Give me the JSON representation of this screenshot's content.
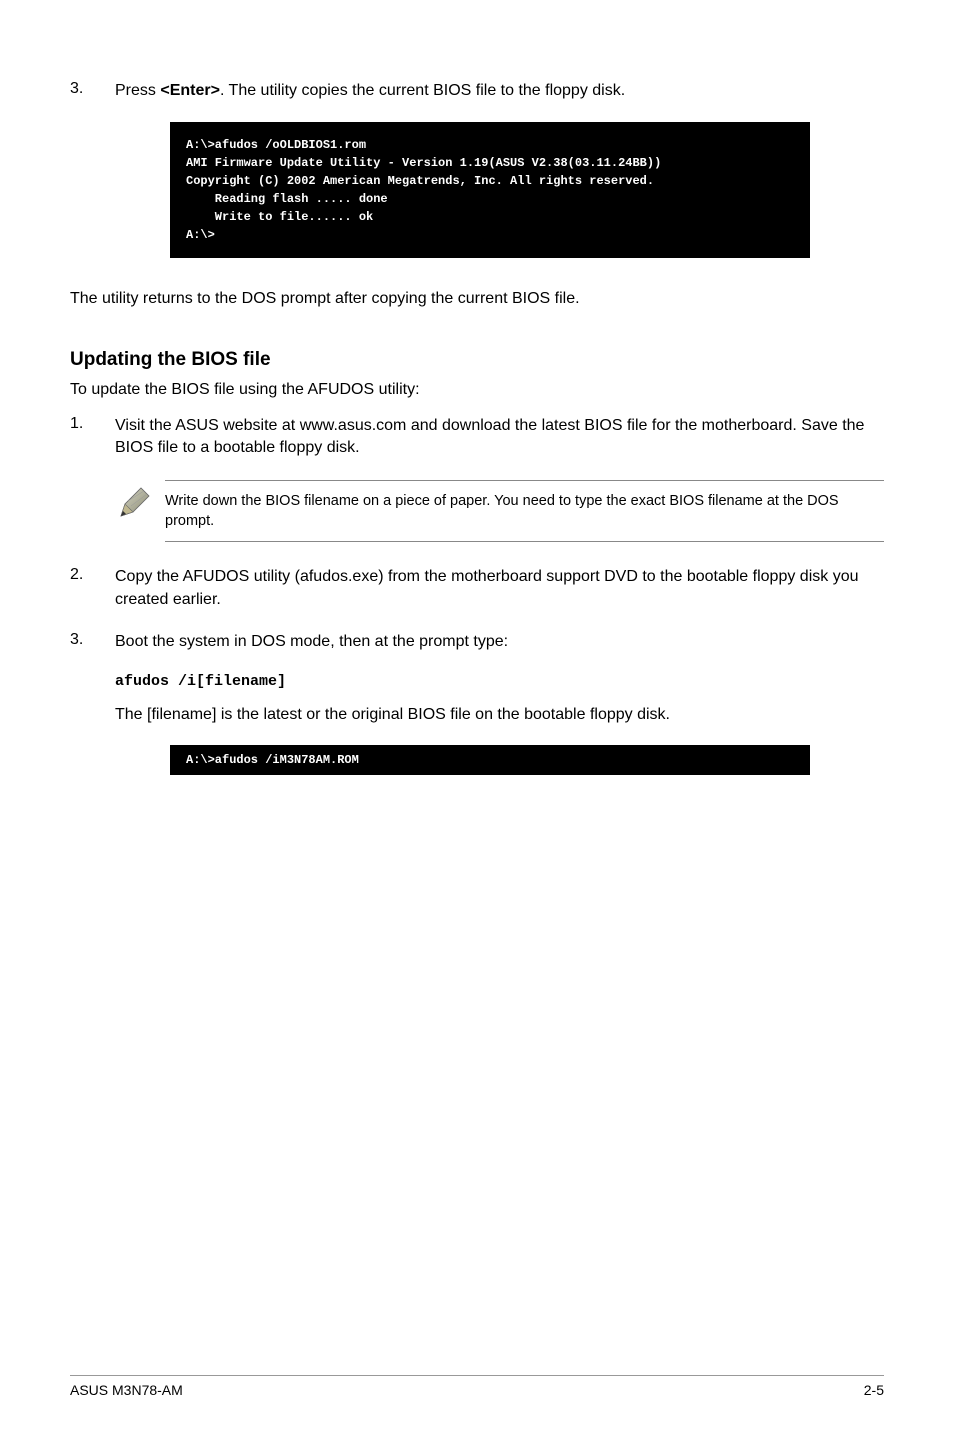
{
  "step3": {
    "num": "3.",
    "prefix": "Press ",
    "bold": "<Enter>",
    "suffix": ". The utility copies the current BIOS file to the floppy disk."
  },
  "terminal1": "A:\\>afudos /oOLDBIOS1.rom\nAMI Firmware Update Utility - Version 1.19(ASUS V2.38(03.11.24BB))\nCopyright (C) 2002 American Megatrends, Inc. All rights reserved.\n    Reading flash ..... done\n    Write to file...... ok\nA:\\>",
  "para1": "The utility returns to the DOS prompt after copying the current BIOS file.",
  "heading": "Updating the BIOS file",
  "subpara": "To update the BIOS file using the AFUDOS utility:",
  "step1b": {
    "num": "1.",
    "text": "Visit the ASUS website at www.asus.com and download the latest BIOS file for the motherboard. Save the BIOS file to a bootable floppy disk."
  },
  "note": "Write down the BIOS filename on a piece of paper. You need to type the exact BIOS filename at the DOS prompt.",
  "step2b": {
    "num": "2.",
    "text": "Copy the AFUDOS utility (afudos.exe) from the motherboard support DVD to the bootable floppy disk you created earlier."
  },
  "step3b": {
    "num": "3.",
    "text": "Boot the system in DOS mode, then at the prompt type:"
  },
  "cmd": "afudos /i[filename]",
  "step3after": "The [filename] is the latest or the original BIOS file on the bootable floppy disk.",
  "terminal2": "A:\\>afudos /iM3N78AM.ROM",
  "footer": {
    "left": "ASUS M3N78-AM",
    "right": "2-5"
  }
}
